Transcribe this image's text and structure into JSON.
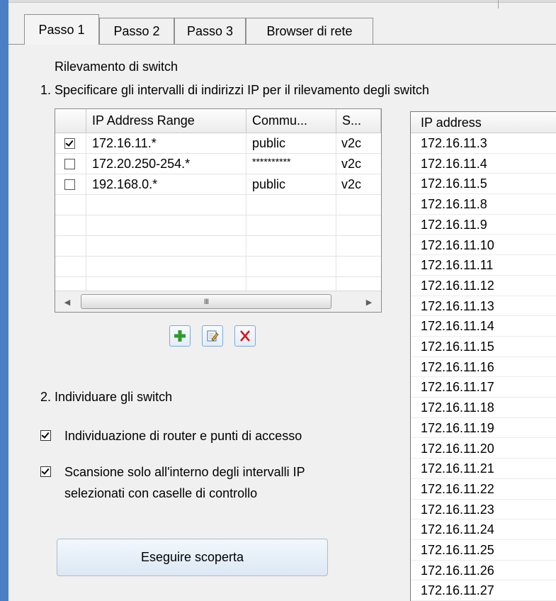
{
  "tabs": [
    "Passo 1",
    "Passo 2",
    "Passo 3",
    "Browser di rete"
  ],
  "section_title": "Rilevamento di switch",
  "step1_text": "1. Specificare gli intervalli di indirizzi IP per il rilevamento degli switch",
  "grid": {
    "columns": [
      "IP Address Range",
      "Commu...",
      "S..."
    ],
    "rows": [
      {
        "checked": true,
        "range": "172.16.11.*",
        "community": "public",
        "version": "v2c"
      },
      {
        "checked": false,
        "range": "172.20.250-254.*",
        "community": "**********",
        "version": "v2c"
      },
      {
        "checked": false,
        "range": "192.168.0.*",
        "community": "public",
        "version": "v2c"
      }
    ],
    "scroll_thumb_grip": "III"
  },
  "toolbar": {
    "add_icon": "plus-icon",
    "edit_icon": "edit-icon",
    "delete_icon": "delete-icon"
  },
  "step2_text": "2. Individuare gli switch",
  "options": [
    {
      "checked": true,
      "label": "Individuazione di router e punti di accesso"
    },
    {
      "checked": true,
      "label": "Scansione solo all'interno degli intervalli IP",
      "label2": "selezionati con caselle di controllo"
    }
  ],
  "discover_button": "Eseguire scoperta",
  "ip_list": {
    "header": "IP address",
    "items": [
      "172.16.11.3",
      "172.16.11.4",
      "172.16.11.5",
      "172.16.11.8",
      "172.16.11.9",
      "172.16.11.10",
      "172.16.11.11",
      "172.16.11.12",
      "172.16.11.13",
      "172.16.11.14",
      "172.16.11.15",
      "172.16.11.16",
      "172.16.11.17",
      "172.16.11.18",
      "172.16.11.19",
      "172.16.11.20",
      "172.16.11.21",
      "172.16.11.22",
      "172.16.11.23",
      "172.16.11.24",
      "172.16.11.25",
      "172.16.11.26",
      "172.16.11.27"
    ]
  }
}
